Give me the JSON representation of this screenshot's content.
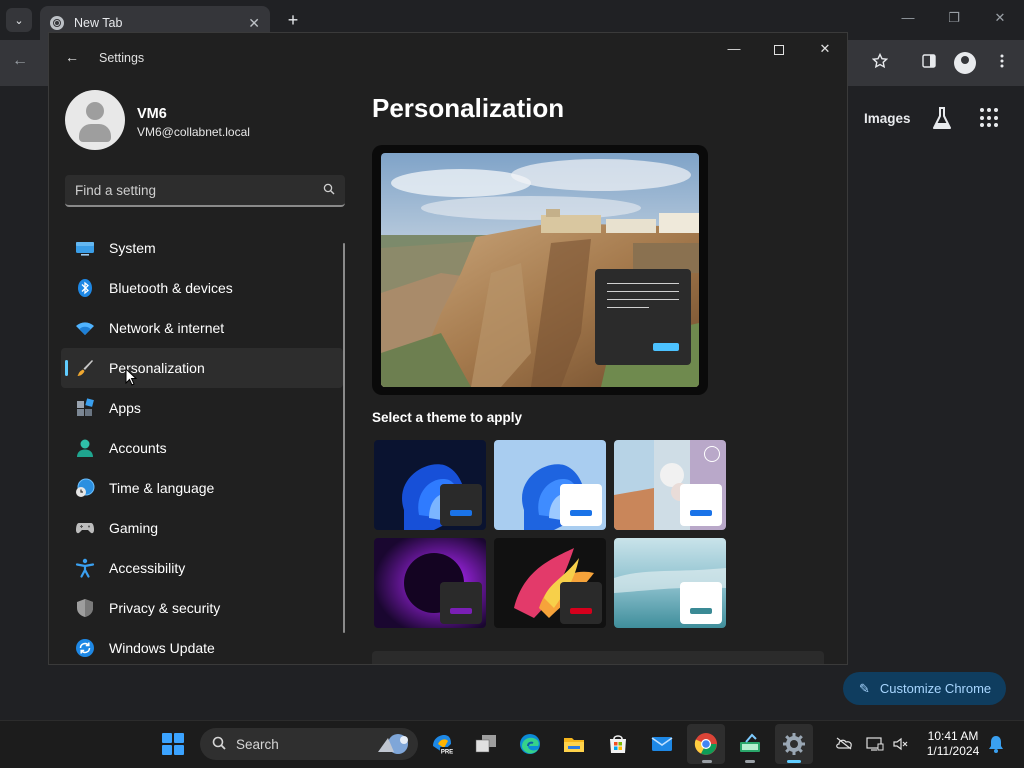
{
  "chrome": {
    "tab_title": "New Tab",
    "tab_close": "✕",
    "new_tab": "+",
    "back": "←",
    "minimize": "—",
    "restore": "❐",
    "close": "✕",
    "ntp_images_link": "Images",
    "customize_label": "Customize Chrome"
  },
  "settings": {
    "window_title": "Settings",
    "back": "←",
    "minimize": "—",
    "close": "✕",
    "profile": {
      "name": "VM6",
      "email": "VM6@collabnet.local"
    },
    "search_placeholder": "Find a setting",
    "nav": [
      {
        "label": "System",
        "icon": "system-icon"
      },
      {
        "label": "Bluetooth & devices",
        "icon": "bluetooth-icon"
      },
      {
        "label": "Network & internet",
        "icon": "wifi-icon"
      },
      {
        "label": "Personalization",
        "icon": "brush-icon",
        "selected": true
      },
      {
        "label": "Apps",
        "icon": "apps-icon"
      },
      {
        "label": "Accounts",
        "icon": "person-icon"
      },
      {
        "label": "Time & language",
        "icon": "globe-clock-icon"
      },
      {
        "label": "Gaming",
        "icon": "gamepad-icon"
      },
      {
        "label": "Accessibility",
        "icon": "accessibility-icon"
      },
      {
        "label": "Privacy & security",
        "icon": "shield-icon"
      },
      {
        "label": "Windows Update",
        "icon": "update-icon"
      }
    ],
    "page_title": "Personalization",
    "theme_heading": "Select a theme to apply",
    "themes": [
      {
        "name": "windows-dark",
        "accent": "#0067c0"
      },
      {
        "name": "windows-light",
        "accent": "#0067c0"
      },
      {
        "name": "windows-spotlight",
        "accent": "#0067c0"
      },
      {
        "name": "glow",
        "accent": "#6b1fa8"
      },
      {
        "name": "captured-motion",
        "accent": "#c8102e"
      },
      {
        "name": "flow",
        "accent": "#3a8a95"
      }
    ]
  },
  "taskbar": {
    "search_label": "Search",
    "time": "10:41 AM",
    "date": "1/11/2024"
  },
  "colors": {
    "settings_accent": "#60cdff",
    "chrome_customize_bg": "#0f3d5f",
    "chrome_customize_text": "#a8d6ff"
  }
}
